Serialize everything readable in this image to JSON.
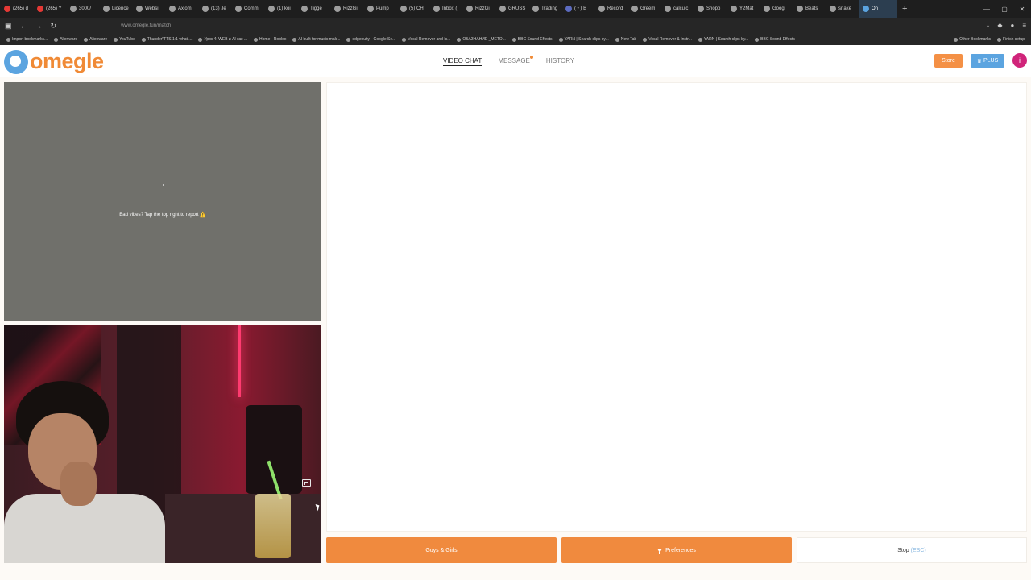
{
  "browser": {
    "tabs": [
      {
        "label": "(265) d",
        "color": "#e53935"
      },
      {
        "label": "(265) Y",
        "color": "#e53935"
      },
      {
        "label": "3000/",
        "color": "#9e9e9e"
      },
      {
        "label": "Licence",
        "color": "#9e9e9e"
      },
      {
        "label": "Websi",
        "color": "#9e9e9e"
      },
      {
        "label": "Axiom",
        "color": "#9e9e9e"
      },
      {
        "label": "(13) Je",
        "color": "#9e9e9e"
      },
      {
        "label": "Comm",
        "color": "#9e9e9e"
      },
      {
        "label": "(1) koi",
        "color": "#9e9e9e"
      },
      {
        "label": "Tigge",
        "color": "#9e9e9e"
      },
      {
        "label": "RizzGi",
        "color": "#9e9e9e"
      },
      {
        "label": "Pump",
        "color": "#9e9e9e"
      },
      {
        "label": "(5) CH",
        "color": "#9e9e9e"
      },
      {
        "label": "Inbox (",
        "color": "#9e9e9e"
      },
      {
        "label": "RizzGi",
        "color": "#9e9e9e"
      },
      {
        "label": "GRUSS",
        "color": "#9e9e9e"
      },
      {
        "label": "Trading",
        "color": "#9e9e9e"
      },
      {
        "label": "( • ) B",
        "color": "#5c6bc0"
      },
      {
        "label": "Record",
        "color": "#9e9e9e"
      },
      {
        "label": "Greem",
        "color": "#9e9e9e"
      },
      {
        "label": "calculc",
        "color": "#9e9e9e"
      },
      {
        "label": "Shopp",
        "color": "#9e9e9e"
      },
      {
        "label": "Y2Mat",
        "color": "#9e9e9e"
      },
      {
        "label": "Googl",
        "color": "#9e9e9e"
      },
      {
        "label": "Beats",
        "color": "#9e9e9e"
      },
      {
        "label": "snake",
        "color": "#9e9e9e"
      }
    ],
    "active_tab": "On",
    "new_tab_icon": "+",
    "url": "www.omegle.fun/match",
    "bookmarks": [
      "Import bookmarks...",
      "Alienware",
      "Alienware",
      "YouTube",
      "Thunder\"TTS 1:1 what ...",
      "Урок 4: WEB и AI как ...",
      "Home - Roblox",
      "AI built for music mak...",
      "edgenuity - Google Se...",
      "Vocal Remover and Is...",
      "ОБАЗНАНИЕ _МЕТО...",
      "BBC Sound Effects",
      "YARN | Search clips by...",
      "New Tab",
      "Vocal Remover & Instr...",
      "YARN | Search clips by...",
      "BBC Sound Effects"
    ],
    "bookmarks_right": [
      "Other Bookmarks",
      "Finish setup"
    ]
  },
  "site": {
    "logo_text": "omegle",
    "nav": {
      "video_chat": "VIDEO CHAT",
      "message": "MESSAGE",
      "history": "HISTORY"
    },
    "store_label": "Store",
    "plus_label": "PLUS",
    "avatar_letter": "i"
  },
  "stranger": {
    "report_text": "Bad vibes? Tap the top right to report",
    "warn_glyph": "⚠️"
  },
  "controls": {
    "gender_label": "Guys & Girls",
    "preferences_label": "Preferences",
    "stop_label": "Stop",
    "stop_key": "(ESC)"
  },
  "colors": {
    "accent_orange": "#f08a3e",
    "accent_blue": "#5ba4e0",
    "avatar": "#d0247a"
  }
}
